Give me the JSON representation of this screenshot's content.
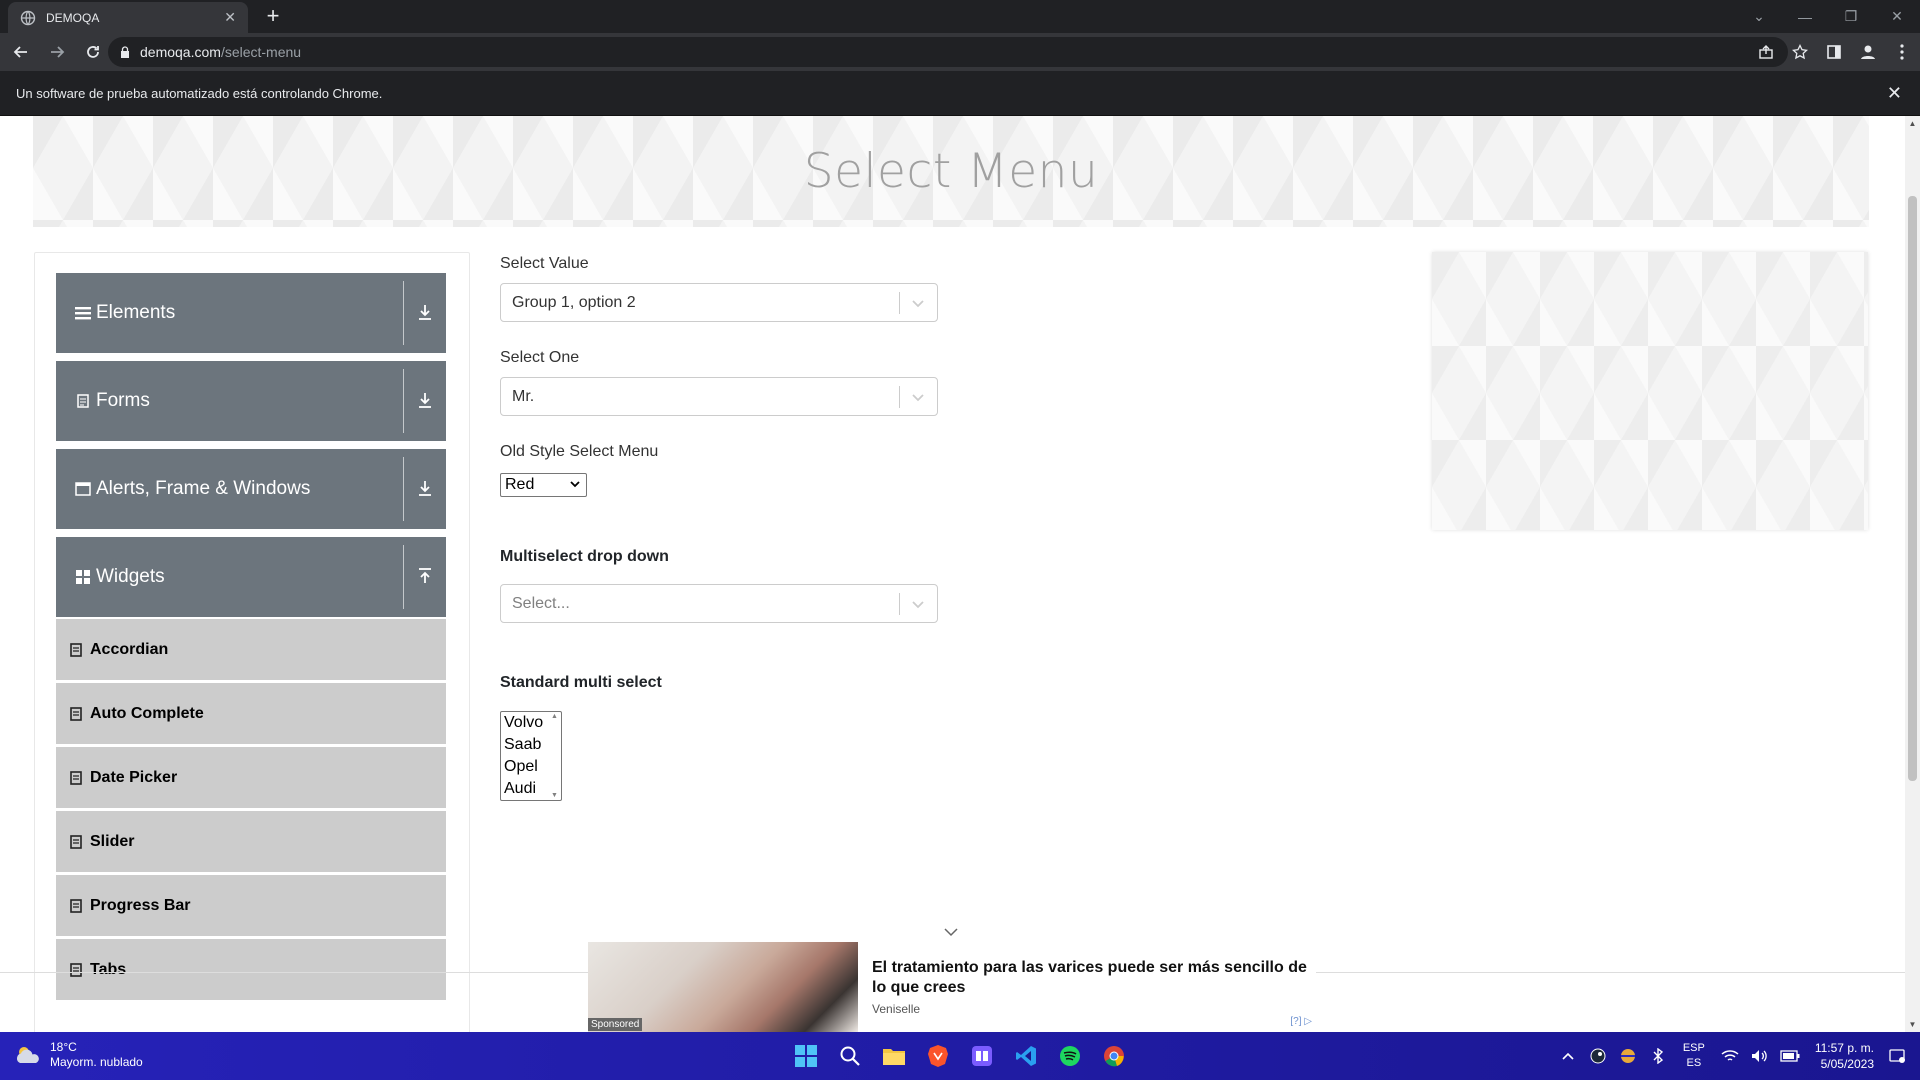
{
  "browser": {
    "tab_title": "DEMOQA",
    "url_host": "demoqa.com",
    "url_path": "/select-menu",
    "automation_notice": "Un software de prueba automatizado está controlando Chrome."
  },
  "page": {
    "title": "Select Menu"
  },
  "sidebar": {
    "groups": [
      {
        "label": "Elements",
        "icon": "hamburger-icon",
        "arrow": "download-arrow-icon"
      },
      {
        "label": "Forms",
        "icon": "form-icon",
        "arrow": "download-arrow-icon"
      },
      {
        "label": "Alerts, Frame & Windows",
        "icon": "window-icon",
        "arrow": "download-arrow-icon"
      },
      {
        "label": "Widgets",
        "icon": "grid-icon",
        "arrow": "upload-arrow-icon"
      }
    ],
    "widget_items": [
      "Accordian",
      "Auto Complete",
      "Date Picker",
      "Slider",
      "Progress Bar",
      "Tabs"
    ]
  },
  "form": {
    "select_value_label": "Select Value",
    "select_value": "Group 1, option 2",
    "select_one_label": "Select One",
    "select_one": "Mr.",
    "old_style_label": "Old Style Select Menu",
    "old_style_value": "Red",
    "multiselect_label": "Multiselect drop down",
    "multiselect_placeholder": "Select...",
    "standard_multi_label": "Standard multi select",
    "standard_multi_options": [
      "Volvo",
      "Saab",
      "Opel",
      "Audi"
    ]
  },
  "ad": {
    "headline": "El tratamiento para las varices puede ser más sencillo de lo que crees",
    "brand": "Veniselle",
    "sponsored_label": "Sponsored",
    "info_label": "[?]"
  },
  "taskbar": {
    "temperature": "18°C",
    "weather": "Mayorm. nublado",
    "lang_1": "ESP",
    "lang_2": "ES",
    "time": "11:57 p. m.",
    "date": "5/05/2023",
    "apps": [
      "windows-start-icon",
      "search-icon",
      "file-explorer-icon",
      "brave-browser-icon",
      "app-purple-icon",
      "vscode-icon",
      "spotify-icon",
      "chrome-icon"
    ]
  },
  "colors": {
    "sidebar_header": "#6c757d",
    "sidebar_item": "#cccccc",
    "taskbar": "#2622b8"
  }
}
